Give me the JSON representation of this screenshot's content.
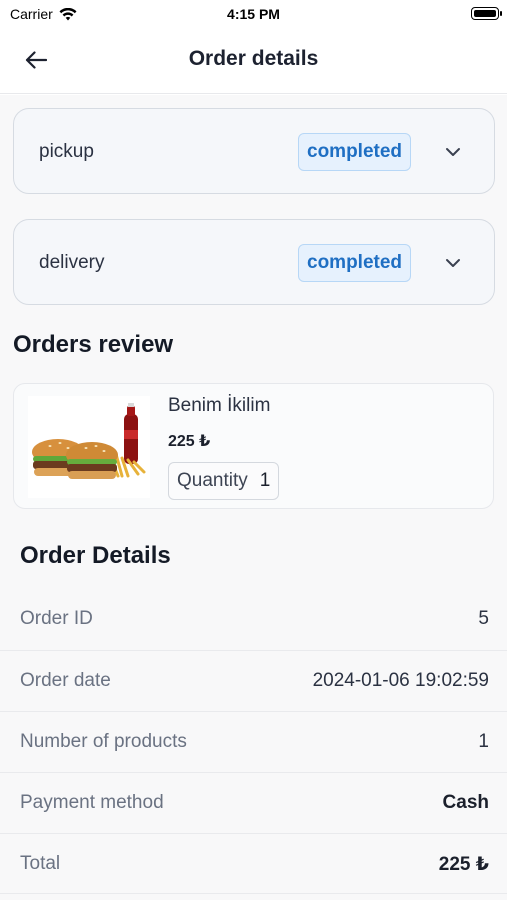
{
  "status_bar": {
    "carrier": "Carrier",
    "time": "4:15 PM"
  },
  "nav": {
    "title": "Order details"
  },
  "status_cards": [
    {
      "label": "pickup",
      "status": "completed"
    },
    {
      "label": "delivery",
      "status": "completed"
    }
  ],
  "orders_review": {
    "title": "Orders review",
    "item": {
      "name": "Benim İkilim",
      "price": "225 ₺",
      "quantity_label": "Quantity",
      "quantity": "1",
      "image": "burger-menu-photo"
    }
  },
  "order_details": {
    "title": "Order Details",
    "rows": [
      {
        "label": "Order ID",
        "value": "5"
      },
      {
        "label": "Order date",
        "value": "2024-01-06 19:02:59"
      },
      {
        "label": "Number of products",
        "value": "1"
      },
      {
        "label": "Payment method",
        "value": "Cash"
      },
      {
        "label": "Total",
        "value": "225 ₺"
      }
    ]
  },
  "icons": {
    "back": "arrow-left-icon",
    "chevron": "chevron-down-icon",
    "wifi": "wifi-icon",
    "battery": "battery-icon"
  },
  "colors": {
    "badge_text": "#1f6fc3",
    "badge_bg": "#e6f1fd",
    "badge_border": "#b7d7f6",
    "card_border": "#d6dbe2",
    "page_bg": "#f8f8f9"
  }
}
